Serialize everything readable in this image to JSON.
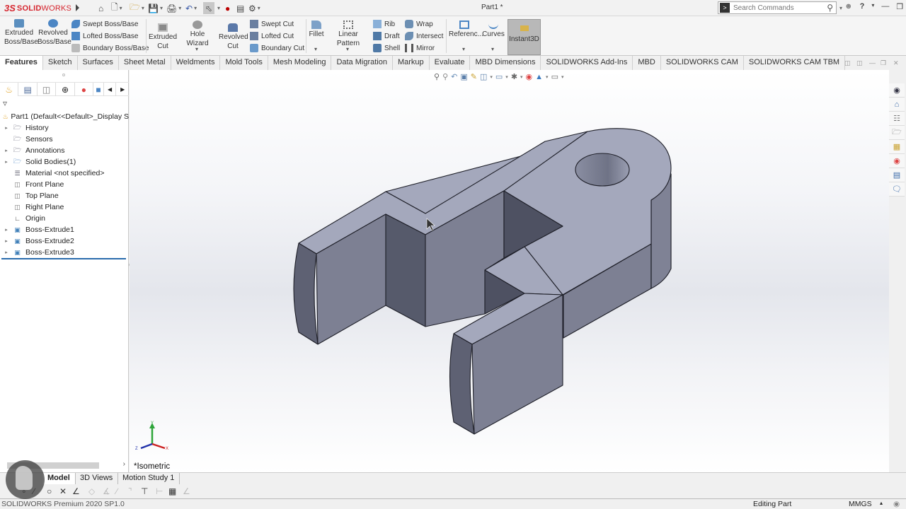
{
  "app": {
    "brand_prefix": "3S",
    "brand_bold": "SOLID",
    "brand_light": "WORKS",
    "document_title": "Part1 *",
    "search": {
      "placeholder": "Search Commands"
    },
    "quick_access": [
      "home",
      "new-document",
      "open",
      "save",
      "print",
      "undo",
      "select",
      "rebuild",
      "file-properties",
      "options"
    ]
  },
  "ribbon": {
    "extruded_boss": "Extruded\nBoss/Base",
    "extruded_boss_l1": "Extruded",
    "extruded_boss_l2": "Boss/Base",
    "revolved_boss_l1": "Revolved",
    "revolved_boss_l2": "Boss/Base",
    "swept_boss": "Swept Boss/Base",
    "lofted_boss": "Lofted Boss/Base",
    "boundary_boss": "Boundary Boss/Base",
    "extruded_cut_l1": "Extruded",
    "extruded_cut_l2": "Cut",
    "hole_wizard": "Hole Wizard",
    "revolved_cut_l1": "Revolved",
    "revolved_cut_l2": "Cut",
    "swept_cut": "Swept Cut",
    "lofted_cut": "Lofted Cut",
    "boundary_cut": "Boundary Cut",
    "fillet": "Fillet",
    "linear_pattern": "Linear Pattern",
    "rib": "Rib",
    "draft": "Draft",
    "shell": "Shell",
    "wrap": "Wrap",
    "intersect": "Intersect",
    "mirror": "Mirror",
    "reference": "Referenc...",
    "curves": "Curves",
    "instant3d": "Instant3D"
  },
  "command_tabs": [
    {
      "label": "Features",
      "active": true
    },
    {
      "label": "Sketch"
    },
    {
      "label": "Surfaces"
    },
    {
      "label": "Sheet Metal"
    },
    {
      "label": "Weldments"
    },
    {
      "label": "Mold Tools"
    },
    {
      "label": "Mesh Modeling"
    },
    {
      "label": "Data Migration"
    },
    {
      "label": "Markup"
    },
    {
      "label": "Evaluate"
    },
    {
      "label": "MBD Dimensions"
    },
    {
      "label": "SOLIDWORKS Add-Ins"
    },
    {
      "label": "MBD"
    },
    {
      "label": "SOLIDWORKS CAM"
    },
    {
      "label": "SOLIDWORKS CAM TBM"
    }
  ],
  "feature_tree": {
    "root": "Part1  (Default<<Default>_Display S",
    "items": [
      {
        "label": "History",
        "expandable": true,
        "icon": "history-folder-icon"
      },
      {
        "label": "Sensors",
        "expandable": false,
        "icon": "sensors-folder-icon"
      },
      {
        "label": "Annotations",
        "expandable": true,
        "icon": "annotations-folder-icon"
      },
      {
        "label": "Solid Bodies(1)",
        "expandable": true,
        "icon": "solid-bodies-folder-icon"
      },
      {
        "label": "Material <not specified>",
        "expandable": false,
        "icon": "material-icon"
      },
      {
        "label": "Front Plane",
        "expandable": false,
        "icon": "plane-icon"
      },
      {
        "label": "Top Plane",
        "expandable": false,
        "icon": "plane-icon"
      },
      {
        "label": "Right Plane",
        "expandable": false,
        "icon": "plane-icon"
      },
      {
        "label": "Origin",
        "expandable": false,
        "icon": "origin-icon"
      },
      {
        "label": "Boss-Extrude1",
        "expandable": true,
        "icon": "extrude-feature-icon"
      },
      {
        "label": "Boss-Extrude2",
        "expandable": true,
        "icon": "extrude-feature-icon"
      },
      {
        "label": "Boss-Extrude3",
        "expandable": true,
        "icon": "extrude-feature-icon"
      }
    ]
  },
  "viewport": {
    "view_name": "*Isometric",
    "model_color": "#a3a7bb",
    "triad": {
      "x": "X",
      "y": "Y",
      "z": "Z"
    }
  },
  "bottom_tabs": [
    {
      "label": "Model",
      "active": true
    },
    {
      "label": "3D Views"
    },
    {
      "label": "Motion Study 1"
    }
  ],
  "status": {
    "product": "SOLIDWORKS Premium 2020 SP1.0",
    "mode": "Editing Part",
    "units": "MMGS"
  }
}
